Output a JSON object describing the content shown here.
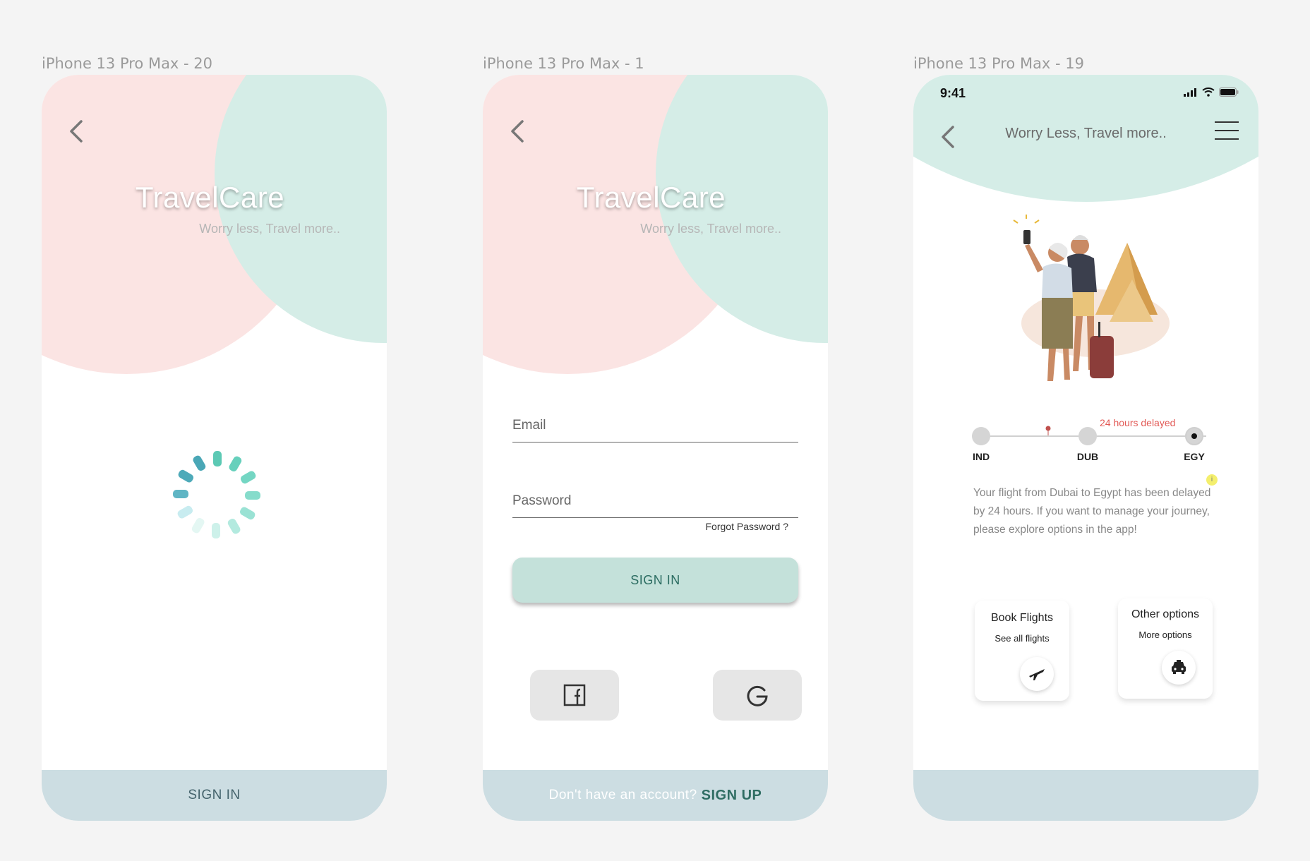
{
  "frames": [
    {
      "label": "iPhone 13 Pro Max - 20"
    },
    {
      "label": "iPhone 13 Pro Max - 1"
    },
    {
      "label": "iPhone 13 Pro Max - 19"
    }
  ],
  "brand": {
    "name": "TravelCare",
    "tagline": "Worry less, Travel more.."
  },
  "loading": {
    "footer_label": "SIGN IN"
  },
  "login": {
    "email_placeholder": "Email",
    "password_placeholder": "Password",
    "forgot_label": "Forgot Password ?",
    "signin_label": "SIGN IN",
    "signup_prompt": "Don't have an account?",
    "signup_link": "SIGN UP",
    "social": [
      "facebook-icon",
      "google-icon"
    ]
  },
  "dashboard": {
    "status_time": "9:41",
    "title": "Worry Less, Travel more..",
    "timeline": {
      "stops": [
        "IND",
        "DUB",
        "EGY"
      ],
      "delay_label": "24 hours delayed"
    },
    "info_label": "i",
    "message": "Your flight from Dubai to Egypt has been delayed by 24 hours. If you want to manage your journey, please explore options in the app!",
    "cards": [
      {
        "title": "Book Flights",
        "subtitle": "See all flights",
        "icon": "plane-icon"
      },
      {
        "title": "Other options",
        "subtitle": "More options",
        "icon": "taxi-icon"
      }
    ]
  },
  "colors": {
    "pink": "#fbe4e3",
    "mint": "#d5ede7",
    "footer": "#ccdde2",
    "accent": "#2f6d63",
    "delay": "#e25a56"
  }
}
